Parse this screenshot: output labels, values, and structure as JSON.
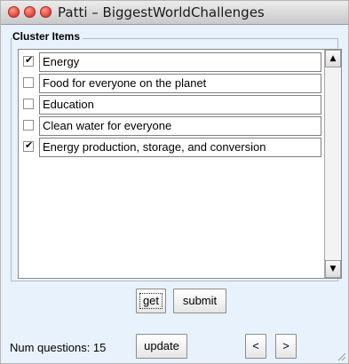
{
  "window": {
    "title": "Patti – BiggestWorldChallenges"
  },
  "cluster": {
    "label": "Cluster Items",
    "items": [
      {
        "checked": true,
        "text": "Energy"
      },
      {
        "checked": false,
        "text": "Food for everyone on the planet"
      },
      {
        "checked": false,
        "text": "Education"
      },
      {
        "checked": false,
        "text": "Clean water for everyone"
      },
      {
        "checked": true,
        "text": "Energy production, storage, and conversion"
      }
    ]
  },
  "scrollbar": {
    "up": "▲",
    "down": "▼"
  },
  "buttons": {
    "get": "get",
    "submit": "submit",
    "update": "update",
    "prev": "<",
    "next": ">"
  },
  "footer": {
    "num_questions": "Num questions: 15"
  },
  "checkmark": "✔"
}
